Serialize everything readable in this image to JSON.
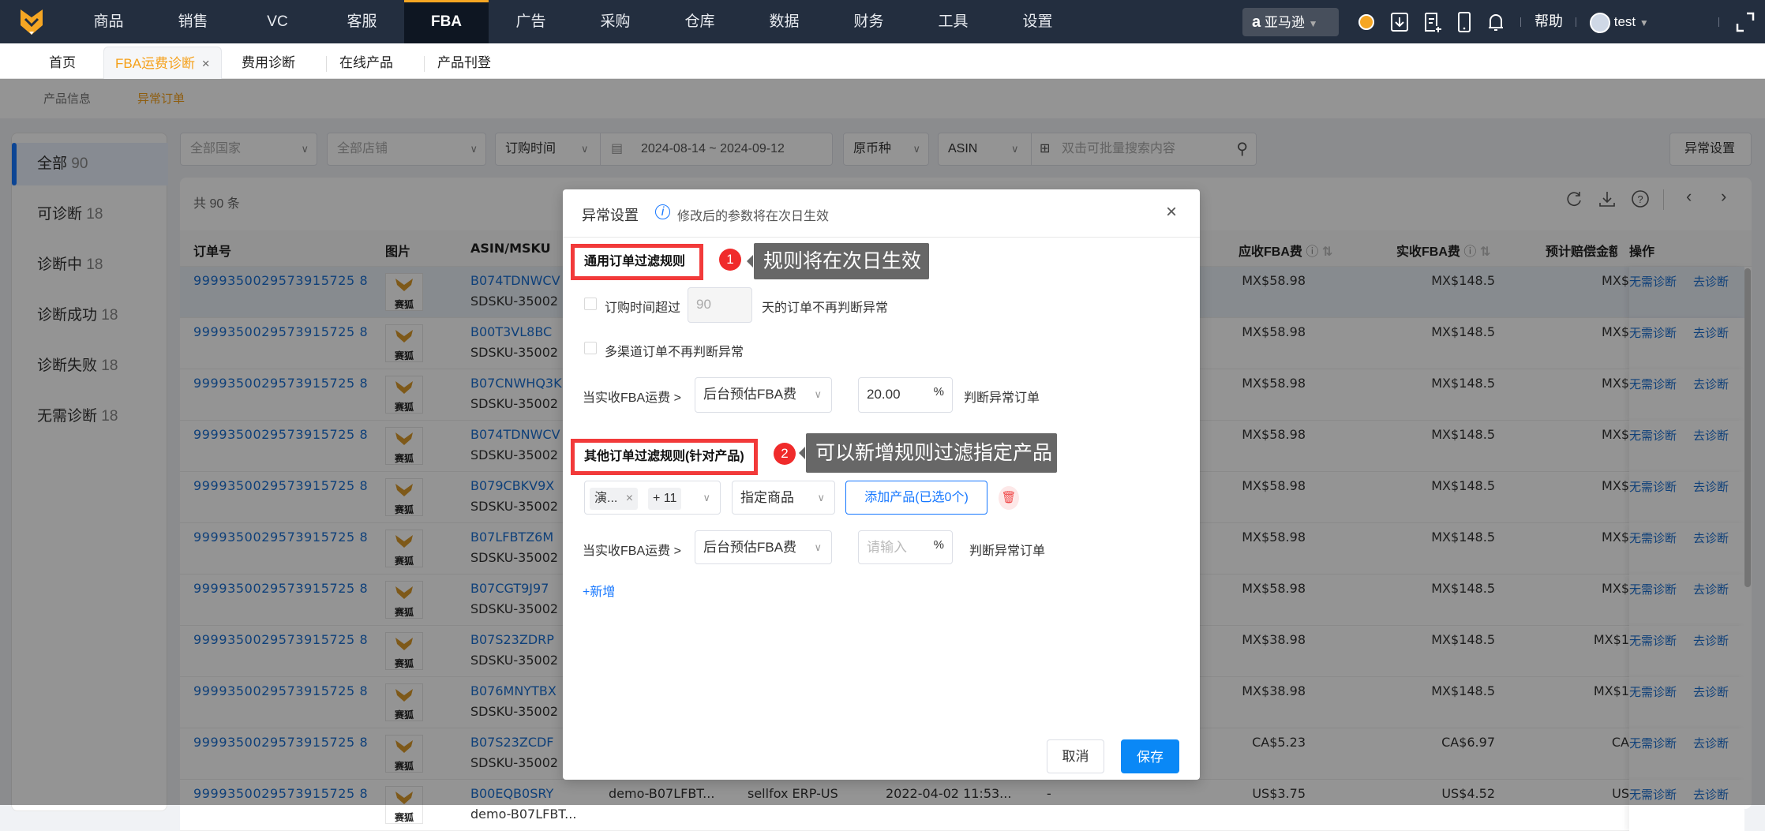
{
  "topnav": {
    "items": [
      "商品",
      "销售",
      "VC",
      "客服",
      "FBA",
      "广告",
      "采购",
      "仓库",
      "数据",
      "财务",
      "工具",
      "设置"
    ],
    "active_index": 4,
    "marketplace": "亚马逊",
    "help": "帮助",
    "user": "test"
  },
  "tabs": [
    {
      "label": "首页"
    },
    {
      "label": "FBA运费诊断",
      "close": "×"
    },
    {
      "label": "费用诊断"
    },
    {
      "label": "在线产品"
    },
    {
      "label": "产品刊登"
    }
  ],
  "subtabs": {
    "product_info": "产品信息",
    "abnormal_orders": "异常订单"
  },
  "sidebar": {
    "items": [
      {
        "label": "全部",
        "count": "90"
      },
      {
        "label": "可诊断",
        "count": "18"
      },
      {
        "label": "诊断中",
        "count": "18"
      },
      {
        "label": "诊断成功",
        "count": "18"
      },
      {
        "label": "诊断失败",
        "count": "18"
      },
      {
        "label": "无需诊断",
        "count": "18"
      }
    ]
  },
  "filters": {
    "country": "全部国家",
    "store": "全部店铺",
    "date_type": "订购时间",
    "date_range": "2024-08-14  ~  2024-09-12",
    "currency": "原币种",
    "search_type": "ASIN",
    "search_placeholder": "双击可批量搜索内容",
    "settings_button": "异常设置"
  },
  "table": {
    "total": "共 90 条",
    "columns": {
      "order": "订单号",
      "image": "图片",
      "asin": "ASIN/MSKU",
      "due_fee": "应收FBA费",
      "actual_fee": "实收FBA费",
      "compensation": "预计赔偿金额",
      "actions": "操作"
    },
    "image_label": "赛狐",
    "actions": {
      "no_need": "无需诊断",
      "diagnose": "去诊断"
    },
    "rows": [
      {
        "order": "9999350029573915725 8",
        "asin": "B074TDNWCV",
        "msku": "SDSKU-35002",
        "due": "MX$58.98",
        "actual": "MX$148.5",
        "comp": "MX$"
      },
      {
        "order": "9999350029573915725 8",
        "asin": "B00T3VL8BC",
        "msku": "SDSKU-35002",
        "due": "MX$58.98",
        "actual": "MX$148.5",
        "comp": "MX$"
      },
      {
        "order": "9999350029573915725 8",
        "asin": "B07CNWHQ3K",
        "msku": "SDSKU-35002",
        "due": "MX$58.98",
        "actual": "MX$148.5",
        "comp": "MX$"
      },
      {
        "order": "9999350029573915725 8",
        "asin": "B074TDNWCV",
        "msku": "SDSKU-35002",
        "due": "MX$58.98",
        "actual": "MX$148.5",
        "comp": "MX$"
      },
      {
        "order": "9999350029573915725 8",
        "asin": "B079CBKV9X",
        "msku": "SDSKU-35002",
        "due": "MX$58.98",
        "actual": "MX$148.5",
        "comp": "MX$"
      },
      {
        "order": "9999350029573915725 8",
        "asin": "B07LFBTZ6M",
        "msku": "SDSKU-35002",
        "due": "MX$58.98",
        "actual": "MX$148.5",
        "comp": "MX$"
      },
      {
        "order": "9999350029573915725 8",
        "asin": "B07CGT9J97",
        "msku": "SDSKU-35002",
        "due": "MX$58.98",
        "actual": "MX$148.5",
        "comp": "MX$"
      },
      {
        "order": "9999350029573915725 8",
        "asin": "B07S23ZDRP",
        "msku": "SDSKU-35002",
        "due": "MX$38.98",
        "actual": "MX$148.5",
        "comp": "MX$1"
      },
      {
        "order": "9999350029573915725 8",
        "asin": "B076MNYTBX",
        "msku": "SDSKU-35002",
        "due": "MX$38.98",
        "actual": "MX$148.5",
        "comp": "MX$1"
      },
      {
        "order": "9999350029573915725 8",
        "asin": "B07S23ZCDF",
        "msku": "SDSKU-35002",
        "due": "CA$5.23",
        "actual": "CA$6.97",
        "comp": "CA"
      },
      {
        "order": "9999350029573915725 8",
        "asin": "B00EQB0SRY",
        "msku": "demo-B07LFBT...",
        "store": "sellfox ERP-US",
        "date": "2022-04-02 11:53...",
        "extra": "-",
        "due": "US$3.75",
        "actual": "US$4.52",
        "comp": "US"
      }
    ]
  },
  "modal": {
    "title": "异常设置",
    "notice": "修改后的参数将在次日生效",
    "section1": {
      "title": "通用订单过滤规则",
      "badge": "1",
      "tooltip": "规则将在次日生效",
      "order_time_label": "订购时间超过",
      "order_time_value": "90",
      "order_time_suffix": "天的订单不再判断异常",
      "multichannel_label": "多渠道订单不再判断异常",
      "rule_label": "当实收FBA运费 >",
      "rule_select": "后台预估FBA费",
      "rule_value": "20.00",
      "percent": "%",
      "rule_suffix": "判断异常订单"
    },
    "section2": {
      "title": "其他订单过滤规则(针对产品)",
      "badge": "2",
      "tooltip": "可以新增规则过滤指定产品",
      "tag": "演...",
      "tag_more": "+ 11",
      "product_select": "指定商品",
      "add_product": "添加产品(已选0个)",
      "rule_label": "当实收FBA运费 >",
      "rule_select": "后台预估FBA费",
      "rule_placeholder": "请输入",
      "percent": "%",
      "rule_suffix": "判断异常订单",
      "add_rule": "+新增"
    },
    "cancel": "取消",
    "save": "保存"
  }
}
